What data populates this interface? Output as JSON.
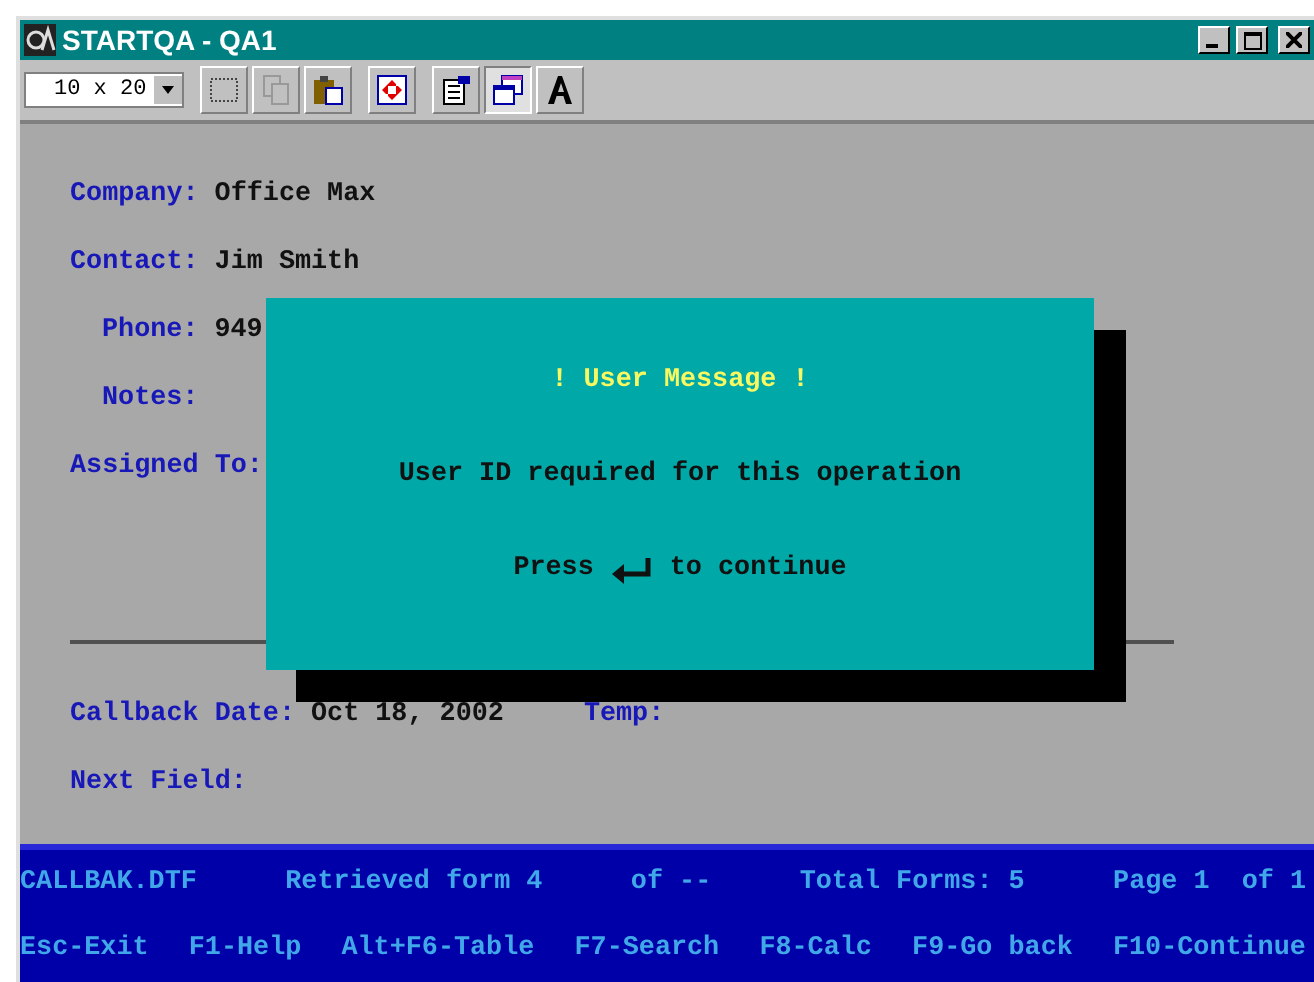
{
  "window": {
    "title": "STARTQA - QA1"
  },
  "toolbar": {
    "font_size": "10 x 20"
  },
  "form": {
    "fields": [
      {
        "label": "Company:",
        "value": "Office Max",
        "indent": false
      },
      {
        "label": "Contact:",
        "value": "Jim Smith",
        "indent": false
      },
      {
        "label": "Phone:",
        "value": "949",
        "indent": true
      },
      {
        "label": "Notes:",
        "indent": true
      },
      {
        "label": "Assigned To:",
        "indent": false
      }
    ],
    "lower_fields": [
      {
        "label": "Callback Date:",
        "value": "Oct 18, 2002",
        "extra_label": "Temp:"
      },
      {
        "label": "Next Field:"
      }
    ]
  },
  "dialog": {
    "title": "! User Message !",
    "message": "User ID required for this operation",
    "prompt_before": "Press",
    "prompt_after": "to continue"
  },
  "status_bar": {
    "info": [
      "CALLBAK.DTF",
      "Retrieved form 4",
      "of --",
      "Total Forms: 5",
      "Page 1  of 1"
    ],
    "keys": [
      "Esc-Exit",
      "F1-Help",
      "Alt+F6-Table",
      "F7-Search",
      "F8-Calc",
      "F9-Go back",
      "F10-Continue"
    ]
  }
}
